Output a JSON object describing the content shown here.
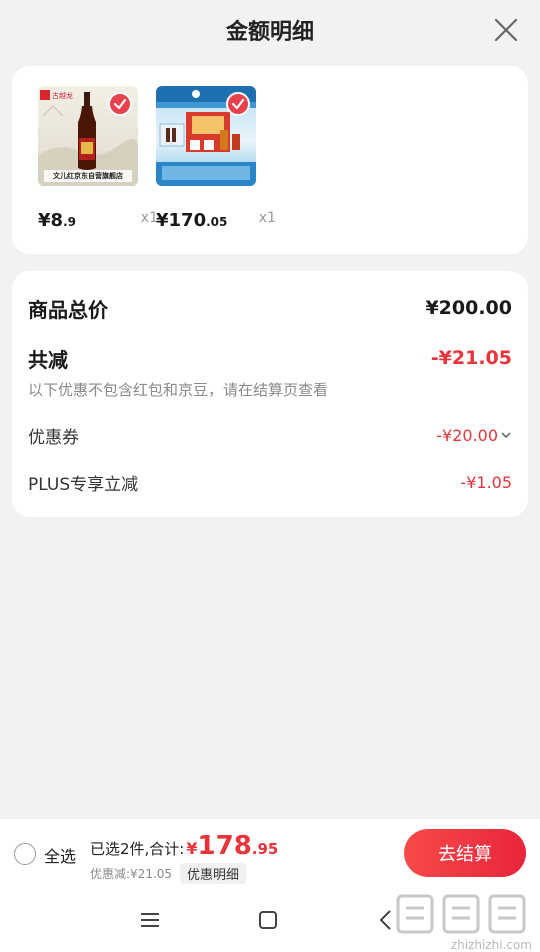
{
  "header": {
    "title": "金额明细"
  },
  "products": [
    {
      "price_int": "¥8",
      "price_dec": ".9",
      "qty": "x1",
      "thumb_text": "文儿红京东自营旗舰店"
    },
    {
      "price_int": "¥170",
      "price_dec": ".05",
      "qty": "x1"
    }
  ],
  "summary": {
    "total_label": "商品总价",
    "total_value": "¥200.00",
    "reduce_label": "共减",
    "reduce_value": "-¥21.05",
    "note": "以下优惠不包含红包和京豆，请在结算页查看",
    "coupon_label": "优惠券",
    "coupon_value": "-¥20.00",
    "plus_label": "PLUS专享立减",
    "plus_value": "-¥1.05"
  },
  "bottom": {
    "select_all": "全选",
    "selected_text": "已选2件,合计:",
    "total_yen": "¥",
    "total_int": "178",
    "total_dec": ".95",
    "saved_text": "优惠减:¥21.05",
    "detail_chip": "优惠明细",
    "checkout": "去结算"
  },
  "watermark": {
    "text": "zhizhizhi.com"
  },
  "colors": {
    "accent": "#e8343a",
    "check": "#e8414d"
  }
}
